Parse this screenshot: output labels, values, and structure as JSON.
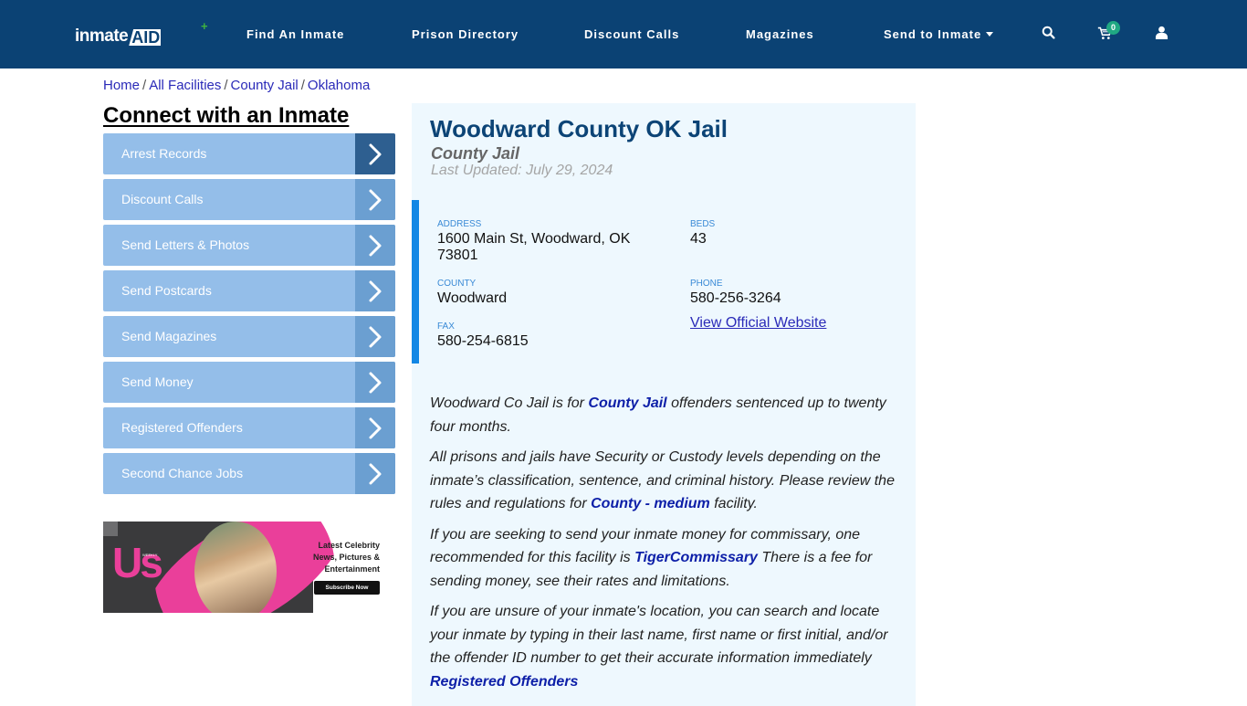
{
  "navbar": {
    "logo_part1": "inmate",
    "logo_part2": "AID",
    "logo_plus": "+",
    "items": [
      {
        "label": "Find An Inmate"
      },
      {
        "label": "Prison Directory"
      },
      {
        "label": "Discount Calls"
      },
      {
        "label": "Magazines"
      },
      {
        "label": "Send to Inmate",
        "has_dropdown": true
      }
    ],
    "icons": [
      "search-icon",
      "cart-icon",
      "user-icon"
    ],
    "cart_count": "0",
    "colors": {
      "background": "#0b4274",
      "badge": "#20a883"
    }
  },
  "breadcrumb": [
    {
      "label": "Home"
    },
    {
      "label": "All Facilities"
    },
    {
      "label": "County Jail"
    },
    {
      "label": "Oklahoma"
    }
  ],
  "breadcrumb_separator": "/",
  "sidebar": {
    "title": "Connect with an Inmate",
    "items": [
      {
        "label": "Arrest Records"
      },
      {
        "label": "Discount Calls"
      },
      {
        "label": "Send Letters & Photos"
      },
      {
        "label": "Send Postcards"
      },
      {
        "label": "Send Magazines"
      },
      {
        "label": "Send Money"
      },
      {
        "label": "Registered Offenders"
      },
      {
        "label": "Second Chance Jobs"
      }
    ]
  },
  "ad": {
    "brand": "Us",
    "brand_sub": "WEEKLY",
    "headline": "Latest Celebrity News, Pictures & Entertainment",
    "cta": "Subscribe Now"
  },
  "facility": {
    "title": "Woodward County OK Jail",
    "type": "County Jail",
    "last_updated": "Last Updated: July 29, 2024",
    "address_label": "ADDRESS",
    "address": "1600 Main St, Woodward, OK 73801",
    "beds_label": "BEDS",
    "beds": "43",
    "county_label": "COUNTY",
    "county": "Woodward",
    "phone_label": "PHONE",
    "phone": "580-256-3264",
    "fax_label": "FAX",
    "fax": "580-254-6815",
    "website_link": "View Official Website"
  },
  "description": {
    "p1_a": "Woodward Co Jail is for ",
    "p1_link": "County Jail",
    "p1_b": " offenders sentenced up to twenty four months.",
    "p2_a": "All prisons and jails have Security or Custody levels depending on the inmate’s classification, sentence, and criminal history. Please review the rules and regulations for ",
    "p2_link": "County - medium",
    "p2_b": " facility.",
    "p3_a": "If you are seeking to send your inmate money for commissary, one recommended for this facility is ",
    "p3_link": "TigerCommissary",
    "p3_b": " There is a fee for sending money, see their rates and limitations.",
    "p4_a": "If you are unsure of your inmate's location, you can search and locate your inmate by typing in their last name, first name or first initial, and/or the offender ID number to get their accurate information immediately ",
    "p4_link": "Registered Offenders"
  }
}
